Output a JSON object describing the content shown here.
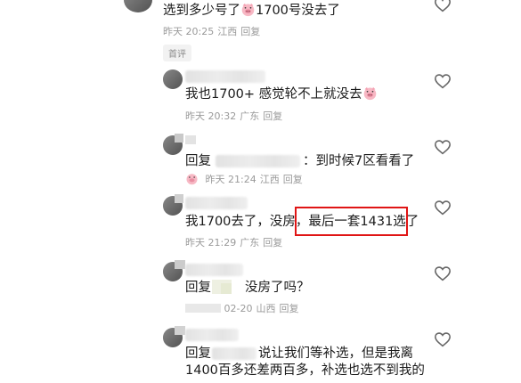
{
  "comments": [
    {
      "text_before": "选到多少号了",
      "text_after": "1700号没去了",
      "time": "昨天 20:25",
      "place": "江西",
      "reply": "回复",
      "tag": "首评"
    },
    {
      "text": "我也1700+  感觉轮不上就没去",
      "time": "昨天 20:32",
      "place": "广东",
      "reply": "回复"
    },
    {
      "prefix": "回复",
      "text": "：到时候7区看看了",
      "time": "昨天 21:24",
      "place": "江西",
      "reply": "回复"
    },
    {
      "text_a": "我1700去了，没房，",
      "text_b": "最后一套1431选了",
      "time": "昨天 21:29",
      "place": "广东",
      "reply": "回复"
    },
    {
      "prefix": "回复",
      "text": "没房了吗？",
      "time": "02-20",
      "place": "山西",
      "reply": "回复"
    },
    {
      "prefix": "回复",
      "line1": "说让我们等补选，但是我离",
      "line2": "1400百多还差两百多，补选也选不到我的"
    }
  ]
}
